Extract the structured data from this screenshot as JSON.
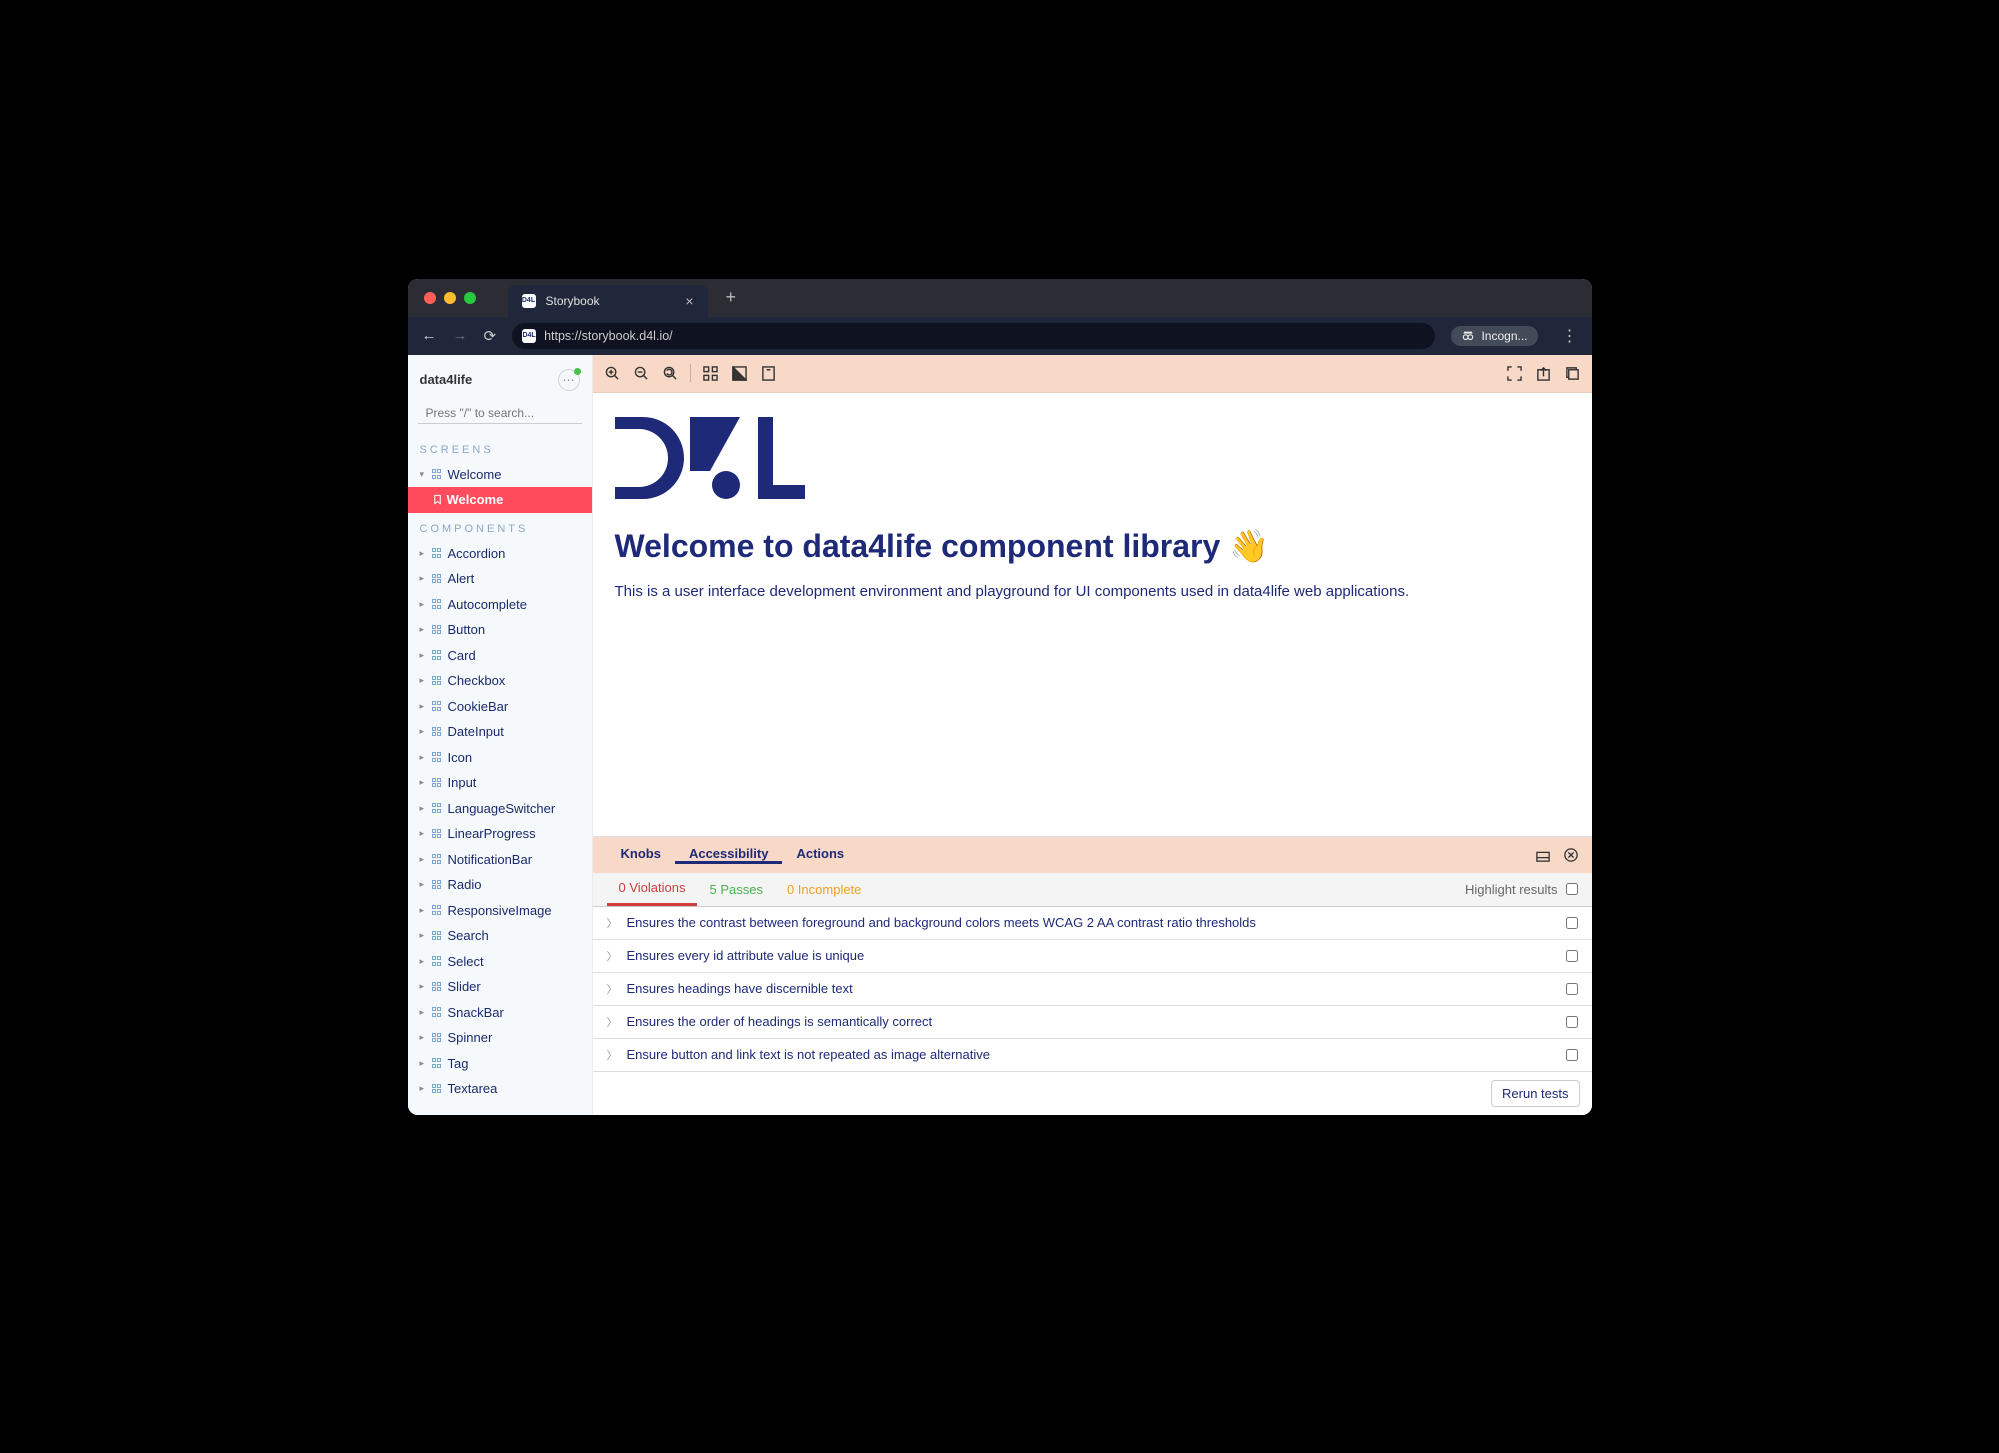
{
  "browser": {
    "tab_title": "Storybook",
    "url": "https://storybook.d4l.io/",
    "incognito_label": "Incogn..."
  },
  "sidebar": {
    "title": "data4life",
    "search_placeholder": "Press \"/\" to search...",
    "section_screens": "SCREENS",
    "section_components": "COMPONENTS",
    "screens": [
      {
        "label": "Welcome",
        "expanded": true,
        "children": [
          {
            "label": "Welcome",
            "active": true
          }
        ]
      }
    ],
    "components": [
      "Accordion",
      "Alert",
      "Autocomplete",
      "Button",
      "Card",
      "Checkbox",
      "CookieBar",
      "DateInput",
      "Icon",
      "Input",
      "LanguageSwitcher",
      "LinearProgress",
      "NotificationBar",
      "Radio",
      "ResponsiveImage",
      "Search",
      "Select",
      "Slider",
      "SnackBar",
      "Spinner",
      "Tag",
      "Textarea"
    ]
  },
  "canvas": {
    "heading": "Welcome to data4life component library 👋",
    "paragraph": "This is a user interface development environment and playground for UI components used in data4life web applications."
  },
  "addons": {
    "tabs": [
      "Knobs",
      "Accessibility",
      "Actions"
    ],
    "active_tab": "Accessibility",
    "sub_tabs": {
      "violations": "0 Violations",
      "passes": "5 Passes",
      "incomplete": "0 Incomplete"
    },
    "highlight_label": "Highlight results",
    "results": [
      "Ensures the contrast between foreground and background colors meets WCAG 2 AA contrast ratio thresholds",
      "Ensures every id attribute value is unique",
      "Ensures headings have discernible text",
      "Ensures the order of headings is semantically correct",
      "Ensure button and link text is not repeated as image alternative"
    ],
    "rerun_label": "Rerun tests"
  }
}
